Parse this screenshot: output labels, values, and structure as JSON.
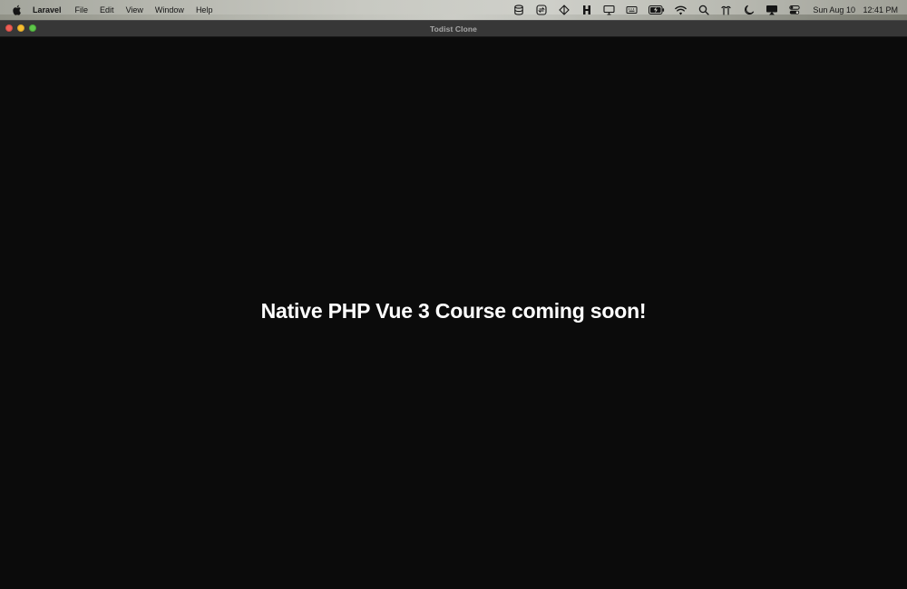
{
  "menubar": {
    "app_name": "Laravel",
    "items": [
      "File",
      "Edit",
      "View",
      "Window",
      "Help"
    ],
    "status_icons": [
      "database-icon",
      "sync-icon",
      "diamond-icon",
      "h-icon",
      "display-icon",
      "keyboard-icon",
      "battery-icon",
      "wifi-icon",
      "search-icon",
      "antenna-icon",
      "moon-icon",
      "screen-mirror-icon",
      "control-center-icon"
    ],
    "date": "Sun Aug 10",
    "time": "12:41 PM"
  },
  "window": {
    "title": "Todist Clone",
    "traffic_light_colors": {
      "close": "#ee5f57",
      "minimize": "#f5bd2f",
      "maximize": "#5fc74a"
    }
  },
  "content": {
    "headline": "Native PHP Vue 3 Course coming soon!"
  }
}
